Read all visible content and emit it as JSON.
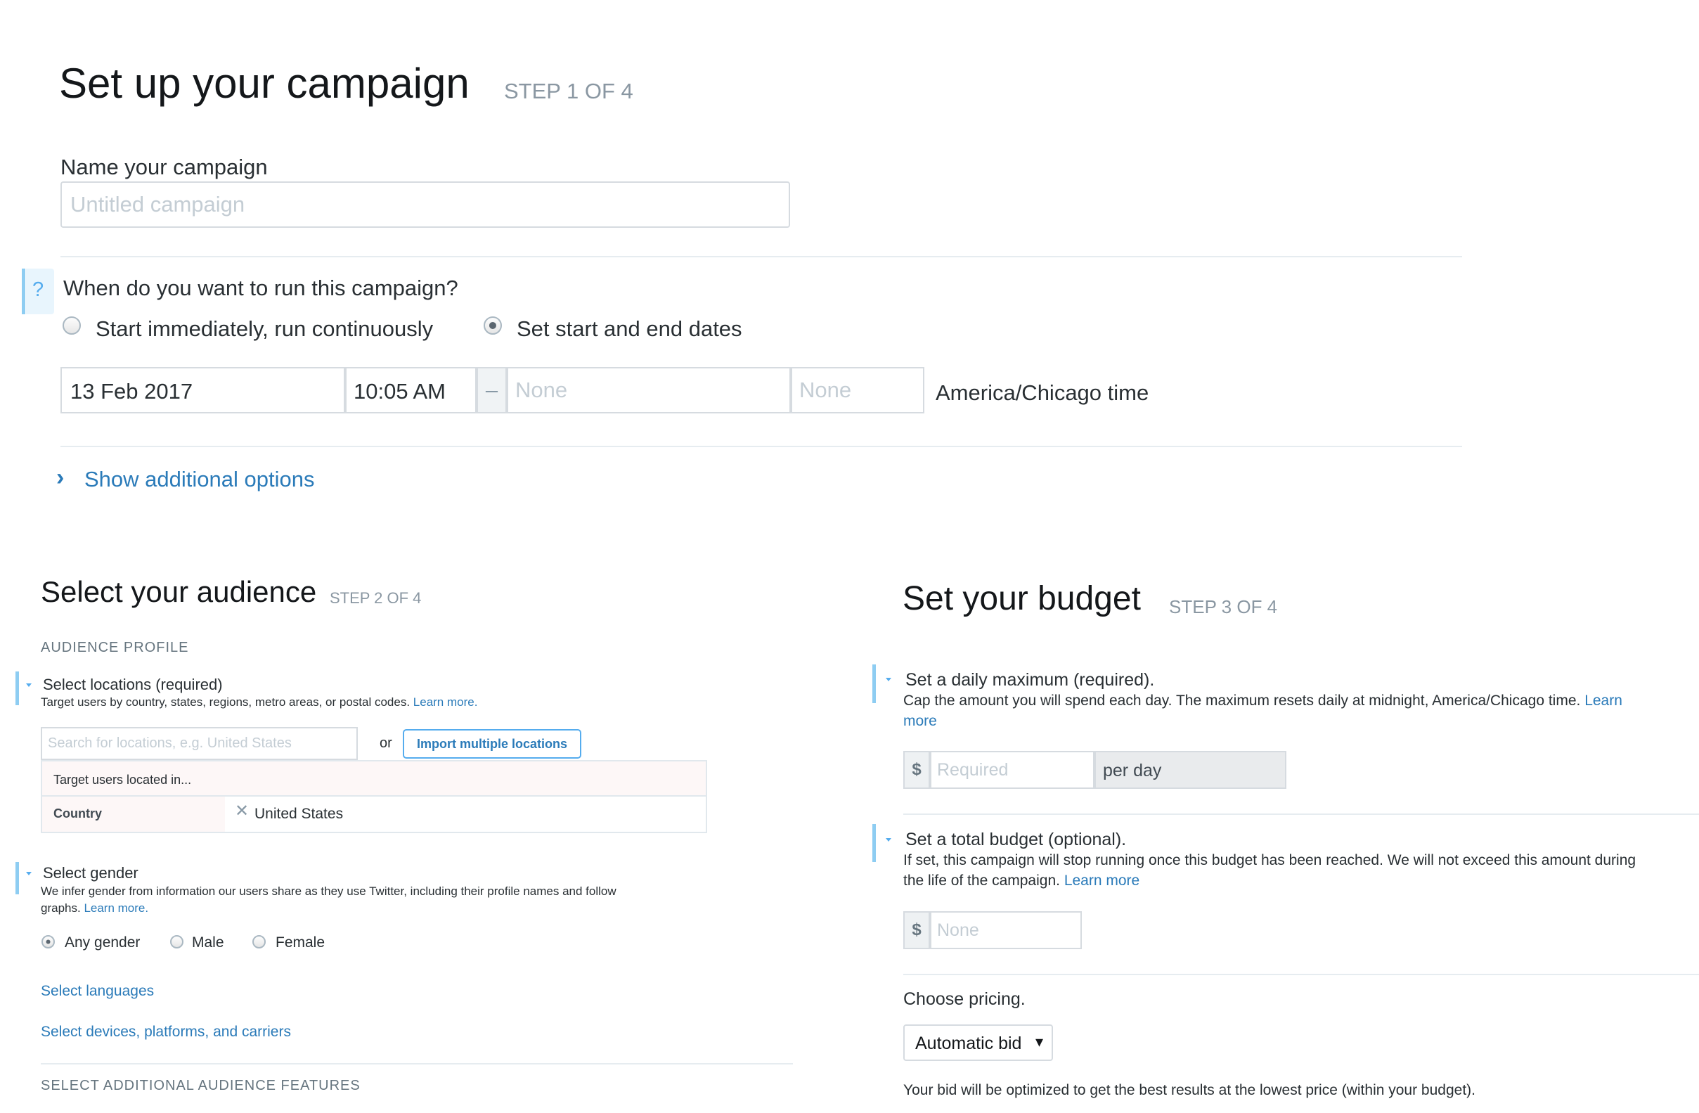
{
  "step1": {
    "title": "Set up your campaign",
    "step": "STEP 1 OF 4",
    "name_label": "Name your campaign",
    "name_placeholder": "Untitled campaign",
    "help_glyph": "?",
    "when_label": "When do you want to run this campaign?",
    "option_immediate": "Start immediately, run continuously",
    "option_dates": "Set start and end dates",
    "start_date": "13 Feb 2017",
    "start_time": "10:05 AM",
    "dash": "–",
    "end_date_placeholder": "None",
    "end_time_placeholder": "None",
    "timezone": "America/Chicago time",
    "additional_options": "Show additional options"
  },
  "step2": {
    "title": "Select your audience",
    "step": "STEP 2 OF 4",
    "section_label": "AUDIENCE PROFILE",
    "locations_title": "Select locations (required)",
    "locations_desc": "Target users by country, states, regions, metro areas, or postal codes.",
    "locations_learn": "Learn more.",
    "search_placeholder": "Search for locations, e.g. United States",
    "or": "or",
    "import_button": "Import multiple locations",
    "target_header": "Target users located in...",
    "country_label": "Country",
    "remove_glyph": "✕",
    "country_value": "United States",
    "gender_title": "Select gender",
    "gender_desc_1": "We infer gender from information our users share as they use Twitter, including their profile names and follow",
    "gender_desc_2": "graphs.",
    "gender_learn": "Learn more.",
    "gender_any": "Any gender",
    "gender_male": "Male",
    "gender_female": "Female",
    "languages_link": "Select languages",
    "devices_link": "Select devices, platforms, and carriers",
    "additional_features": "SELECT ADDITIONAL AUDIENCE FEATURES"
  },
  "step3": {
    "title": "Set your budget",
    "step": "STEP 3 OF 4",
    "daily_title": "Set a daily maximum (required).",
    "daily_desc": "Cap the amount you will spend each day. The maximum resets daily at midnight, America/Chicago time.",
    "daily_learn_1": "Learn",
    "daily_learn_2": "more",
    "currency": "$",
    "daily_placeholder": "Required",
    "per_day": "per day",
    "total_title": "Set a total budget (optional).",
    "total_desc_1": "If set, this campaign will stop running once this budget has been reached. We will not exceed this amount during",
    "total_desc_2": "the life of the campaign.",
    "total_learn": "Learn more",
    "total_placeholder": "None",
    "pricing_label": "Choose pricing.",
    "pricing_value": "Automatic bid",
    "pricing_caret": "▾",
    "pricing_note": "Your bid will be optimized to get the best results at the lowest price (within your budget)."
  }
}
